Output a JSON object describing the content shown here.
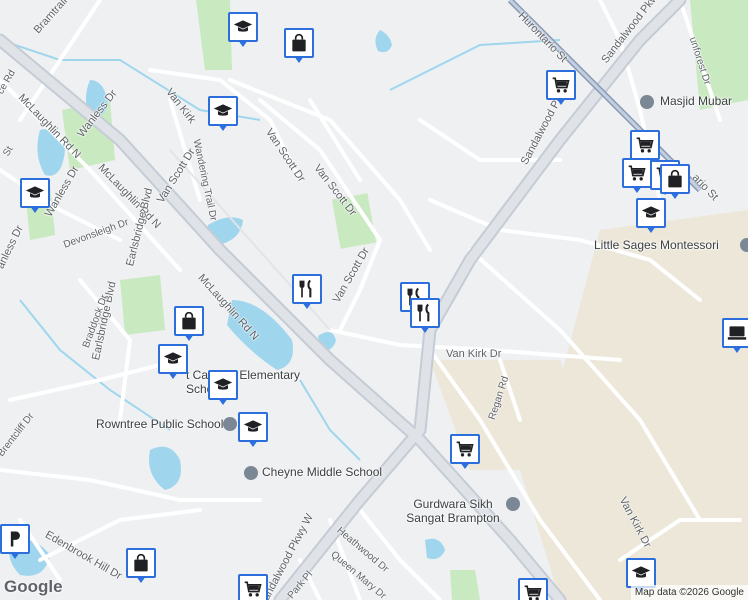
{
  "map": {
    "attribution": "Map data ©2026 Google",
    "logo": "Google",
    "colors": {
      "background": "#eef0f2",
      "road": "#ffffff",
      "highway": "#c5ccd6",
      "water": "#9fd6ee",
      "park": "#c9e9c0",
      "pin_border": "#2c6fdc",
      "poi_marker": "#7b8794"
    }
  },
  "streets": {
    "bramtrail_gate": "Bramtrail Gate",
    "mclaughlin_rd_n_1": "McLaughlin Rd N",
    "mclaughlin_rd_n_2": "McLaughlin Rd N",
    "mclaughlin_rd_n_3": "McLaughlin Rd N",
    "wanless_dr_1": "Wanless Dr",
    "wanless_dr_2": "Wanless Dr",
    "wanless_dr_3": "anless Dr",
    "van_kirk_dr_1": "Van Kirk",
    "van_kirk_dr_2": "Van Kirk Dr",
    "van_kirk_dr_3": "Van Kirk Dr",
    "van_scott_dr_1": "Van Scott Dr",
    "van_scott_dr_2": "Van Scott Dr",
    "van_scott_dr_3": "Van Scott Dr",
    "van_scott_dr_4": "Van Scott Dr",
    "wandering_trail_dr": "Wandering Trail Dr",
    "earlsbridge_blvd_1": "Earlsbridge Blvd",
    "earlsbridge_blvd_2": "Earlsbridge Blvd",
    "devonsleigh_dr": "Devonsleigh Dr",
    "braddock_dr": "Braddock Dr",
    "brentcliff_dr": "Brentcliff Dr",
    "edenbrook_hill_dr": "Edenbrook Hill Dr",
    "sandalwood_pkwy_w_1": "Sandalwood Pkwy W",
    "sandalwood_pkwy_w_2": "Sandalwood Pkwy W",
    "sandalwood_pkwy_e": "Sandalwood Pkwy",
    "hurontario_st_1": "Hurontario St",
    "hurontario_st_2": "ario St",
    "regan_rd": "Regan Rd",
    "heathwood_dr": "Heathwood Dr",
    "queen_mary_dr": "Queen Mary Dr",
    "park_pl": "Park Pl",
    "sunforest_dr": "unforest Dr",
    "ce_rd": "ce Rd",
    "st": "St"
  },
  "places": {
    "masjid": "Masjid Mubar",
    "little_sages": "Little Sages Montessori",
    "catholic_school": "t Catholic Elementary School",
    "rowntree": "Rowntree Public School",
    "cheyne": "Cheyne Middle School",
    "gurdwara": "Gurdwara Sikh Sangat Brampton"
  },
  "pins": [
    {
      "type": "school",
      "icon": "school-icon"
    },
    {
      "type": "shopping",
      "icon": "shopping-bag-icon"
    },
    {
      "type": "school",
      "icon": "school-icon"
    },
    {
      "type": "grocery",
      "icon": "shopping-cart-icon"
    },
    {
      "type": "school",
      "icon": "school-icon"
    },
    {
      "type": "grocery",
      "icon": "shopping-cart-icon"
    },
    {
      "type": "grocery",
      "icon": "shopping-cart-icon"
    },
    {
      "type": "grocery",
      "icon": "shopping-cart-icon"
    },
    {
      "type": "shopping",
      "icon": "shopping-bag-icon"
    },
    {
      "type": "school",
      "icon": "school-icon"
    },
    {
      "type": "restaurant",
      "icon": "restaurant-icon"
    },
    {
      "type": "restaurant",
      "icon": "restaurant-icon"
    },
    {
      "type": "restaurant",
      "icon": "restaurant-icon"
    },
    {
      "type": "shopping",
      "icon": "shopping-bag-icon"
    },
    {
      "type": "school",
      "icon": "school-icon"
    },
    {
      "type": "school",
      "icon": "school-icon"
    },
    {
      "type": "school",
      "icon": "school-icon"
    },
    {
      "type": "grocery",
      "icon": "shopping-cart-icon"
    },
    {
      "type": "computer",
      "icon": "computer-icon"
    },
    {
      "type": "shopping",
      "icon": "shopping-bag-icon"
    },
    {
      "type": "grocery",
      "icon": "shopping-cart-icon"
    },
    {
      "type": "grocery",
      "icon": "shopping-cart-icon"
    },
    {
      "type": "school",
      "icon": "school-icon"
    },
    {
      "type": "parking",
      "icon": "parking-icon"
    }
  ]
}
